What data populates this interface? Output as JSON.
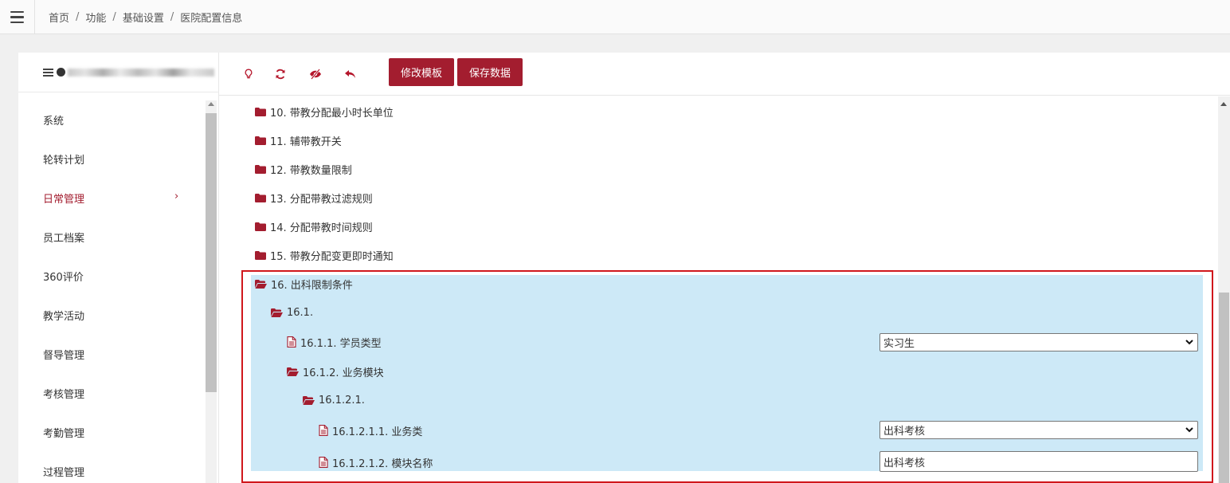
{
  "breadcrumb": [
    "首页",
    "功能",
    "基础设置",
    "医院配置信息"
  ],
  "sidebar": {
    "items": [
      {
        "label": "系统"
      },
      {
        "label": "轮转计划"
      },
      {
        "label": "日常管理",
        "arrow": "›"
      },
      {
        "label": "员工档案"
      },
      {
        "label": "360评价"
      },
      {
        "label": "教学活动"
      },
      {
        "label": "督导管理"
      },
      {
        "label": "考核管理"
      },
      {
        "label": "考勤管理"
      },
      {
        "label": "过程管理"
      }
    ]
  },
  "toolbar": {
    "icons": [
      "bulb-icon",
      "refresh-icon",
      "eye-slash-icon",
      "undo-icon"
    ],
    "modify_template_label": "修改模板",
    "save_data_label": "保存数据"
  },
  "tree": {
    "items": [
      {
        "label": "10. 带教分配最小时长单位"
      },
      {
        "label": "11. 辅带教开关"
      },
      {
        "label": "12. 带教数量限制"
      },
      {
        "label": "13. 分配带教过滤规则"
      },
      {
        "label": "14. 分配带教时间规则"
      },
      {
        "label": "15. 带教分配变更即时通知"
      },
      {
        "label": "16. 出科限制条件"
      },
      {
        "label": "16.1."
      },
      {
        "label": "16.1.1. 学员类型",
        "value": "实习生"
      },
      {
        "label": "16.1.2. 业务模块"
      },
      {
        "label": "16.1.2.1."
      },
      {
        "label": "16.1.2.1.1. 业务类",
        "value": "出科考核"
      },
      {
        "label": "16.1.2.1.2. 模块名称",
        "value": "出科考核"
      }
    ]
  },
  "colors": {
    "accent": "#a31d2f",
    "highlight": "#cde9f7",
    "annotation_box": "#d0171c"
  }
}
